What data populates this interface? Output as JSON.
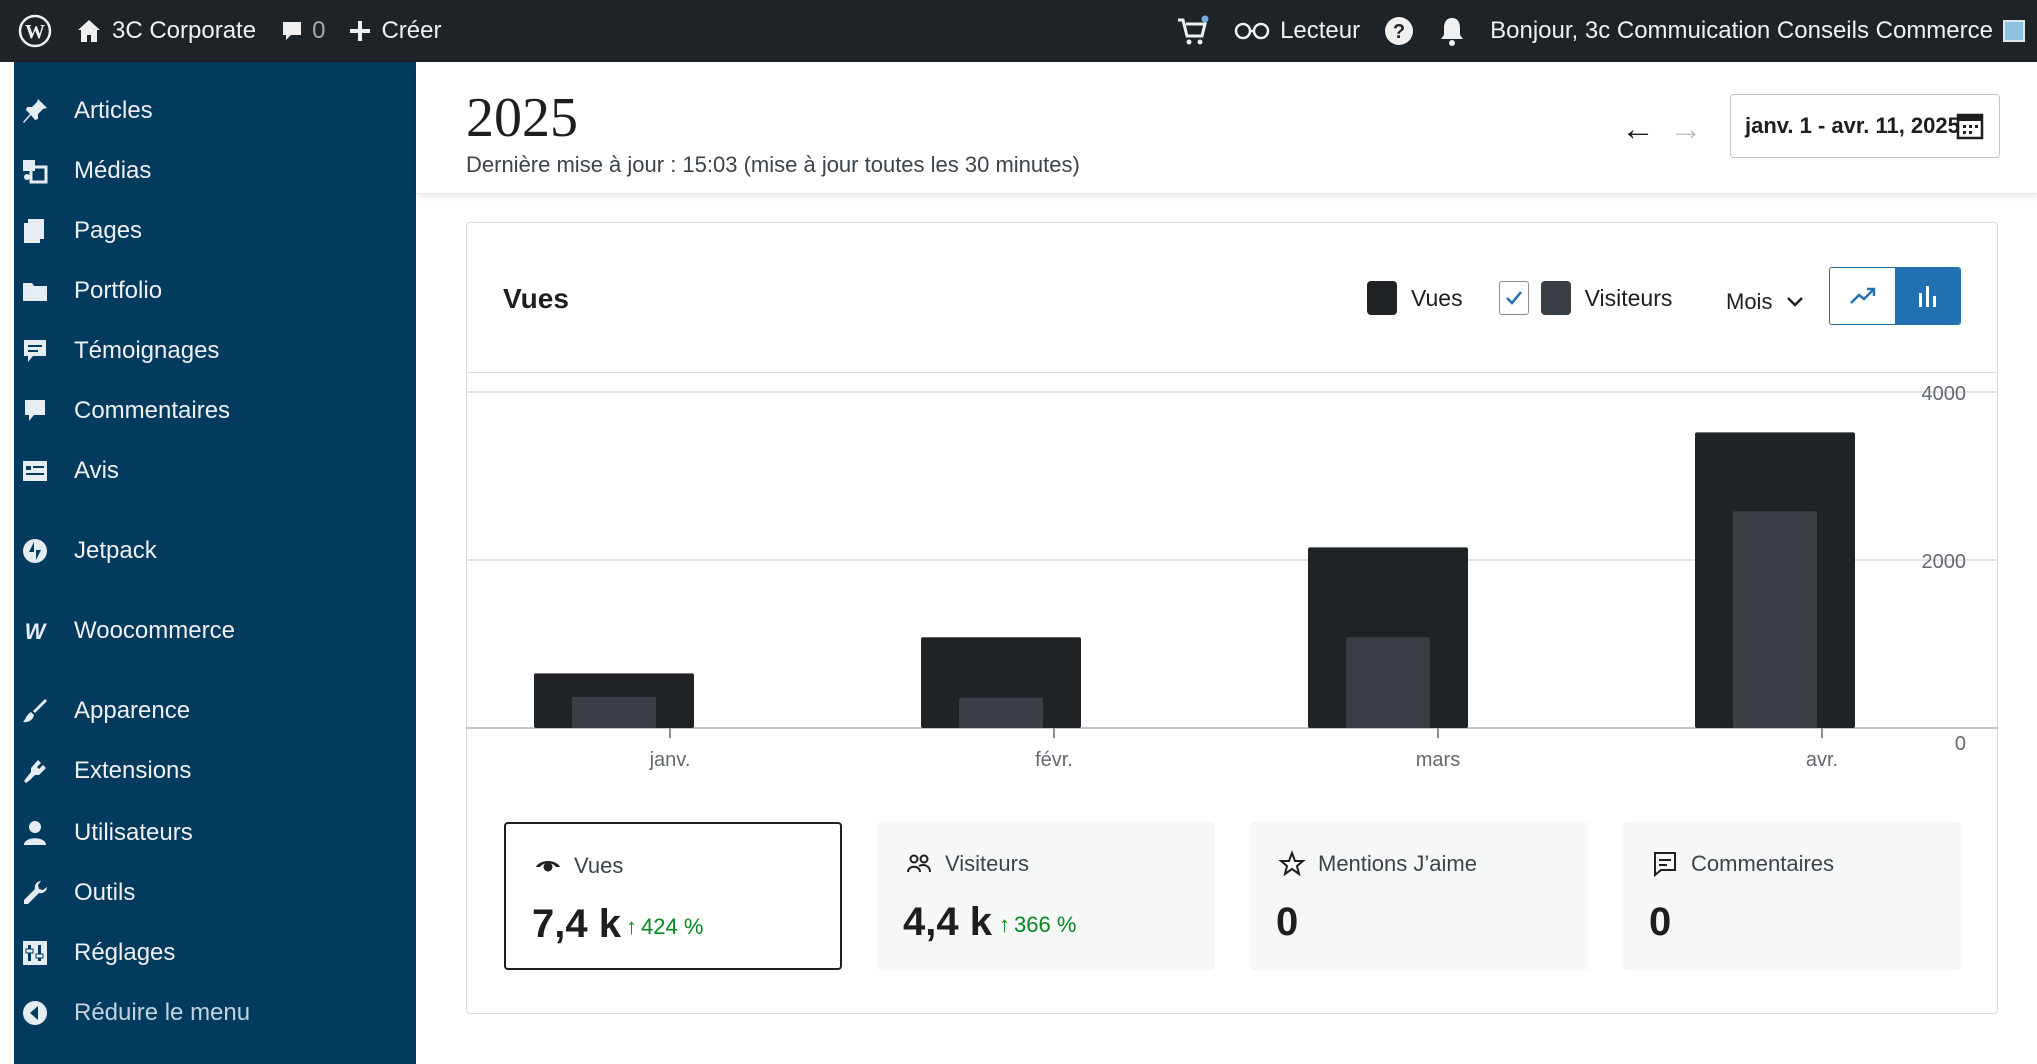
{
  "adminbar": {
    "site_name": "3C Corporate",
    "comments_count": "0",
    "create_label": "Créer",
    "reader_label": "Lecteur",
    "greeting": "Bonjour, 3c Commuication Conseils Commerce"
  },
  "sidebar": {
    "items": [
      {
        "label": "Articles",
        "icon": "pin-icon"
      },
      {
        "label": "Médias",
        "icon": "media-icon"
      },
      {
        "label": "Pages",
        "icon": "pages-icon"
      },
      {
        "label": "Portfolio",
        "icon": "folder-icon"
      },
      {
        "label": "Témoignages",
        "icon": "testimonial-icon"
      },
      {
        "label": "Commentaires",
        "icon": "comment-icon"
      },
      {
        "label": "Avis",
        "icon": "feedback-icon"
      },
      {
        "label": "Jetpack",
        "icon": "jetpack-icon"
      },
      {
        "label": "Woocommerce",
        "icon": "woocommerce-icon"
      },
      {
        "label": "Apparence",
        "icon": "brush-icon"
      },
      {
        "label": "Extensions",
        "icon": "plugin-icon"
      },
      {
        "label": "Utilisateurs",
        "icon": "user-icon"
      },
      {
        "label": "Outils",
        "icon": "wrench-icon"
      },
      {
        "label": "Réglages",
        "icon": "settings-icon"
      },
      {
        "label": "Réduire le menu",
        "icon": "collapse-icon"
      }
    ]
  },
  "header": {
    "year": "2025",
    "last_update": "Dernière mise à jour : 15:03 (mise à jour toutes les 30 minutes)",
    "date_range": "janv. 1 - avr. 11, 2025"
  },
  "card": {
    "title": "Vues",
    "legend_views": "Vues",
    "legend_visitors": "Visiteurs",
    "period": "Mois"
  },
  "chart_data": {
    "type": "bar",
    "categories": [
      "janv.",
      "févr.",
      "mars",
      "avr."
    ],
    "series": [
      {
        "name": "Vues",
        "values": [
          650,
          1080,
          2150,
          3520
        ],
        "color": "#1f2326"
      },
      {
        "name": "Visiteurs",
        "values": [
          370,
          360,
          1080,
          2580
        ],
        "color": "#3a3f45"
      }
    ],
    "ylim": [
      0,
      4000
    ],
    "yticks": [
      "0",
      "2000",
      "4000"
    ],
    "grid": true
  },
  "stats": [
    {
      "label": "Vues",
      "value": "7,4 k",
      "delta": "424 %",
      "icon": "eye-icon"
    },
    {
      "label": "Visiteurs",
      "value": "4,4 k",
      "delta": "366 %",
      "icon": "people-icon"
    },
    {
      "label": "Mentions J’aime",
      "value": "0",
      "delta": "",
      "icon": "star-icon"
    },
    {
      "label": "Commentaires",
      "value": "0",
      "delta": "",
      "icon": "comment-box-icon"
    }
  ],
  "colors": {
    "sidebar": "#023b5e",
    "adminbar": "#1d2327",
    "accent": "#2271b1",
    "positive": "#008a20"
  }
}
